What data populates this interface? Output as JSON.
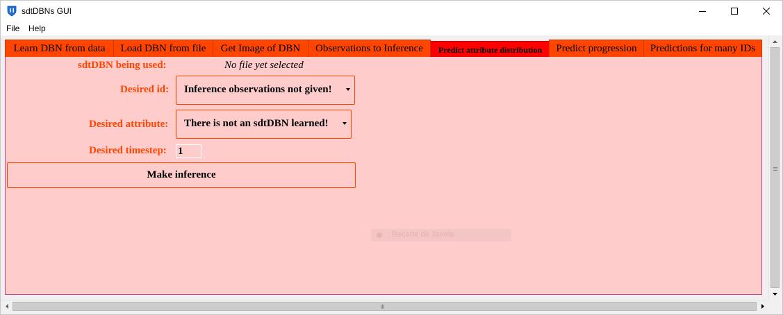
{
  "window": {
    "title": "sdtDBNs GUI"
  },
  "menu": {
    "items": [
      "File",
      "Help"
    ]
  },
  "tabs": [
    {
      "label": "Learn DBN from data"
    },
    {
      "label": "Load DBN from file"
    },
    {
      "label": "Get Image of DBN"
    },
    {
      "label": "Observations to Inference"
    },
    {
      "label": "Predict attribute distribution",
      "active": true
    },
    {
      "label": "Predict progression"
    },
    {
      "label": "Predictions for many IDs"
    }
  ],
  "form": {
    "model_label": "sdtDBN being used:",
    "model_value": "No file yet selected",
    "id_label": "Desired id:",
    "id_selected": "Inference observations not given!",
    "attribute_label": "Desired attribute:",
    "attribute_selected": "There is not an sdtDBN learned!",
    "timestep_label": "Desired timestep:",
    "timestep_value": "1",
    "make_inference_label": "Make inference"
  },
  "ghost_text": "Recorte de Janela",
  "colors": {
    "tab": "#ff4500",
    "active_tab": "#ff0000",
    "panel_bg": "#ffcccc",
    "label": "#ff4500"
  },
  "icons": {
    "app": "shield-icon",
    "minimize": "minimize-icon",
    "maximize": "maximize-icon",
    "close": "close-icon",
    "dropdown": "chevron-down-icon"
  }
}
